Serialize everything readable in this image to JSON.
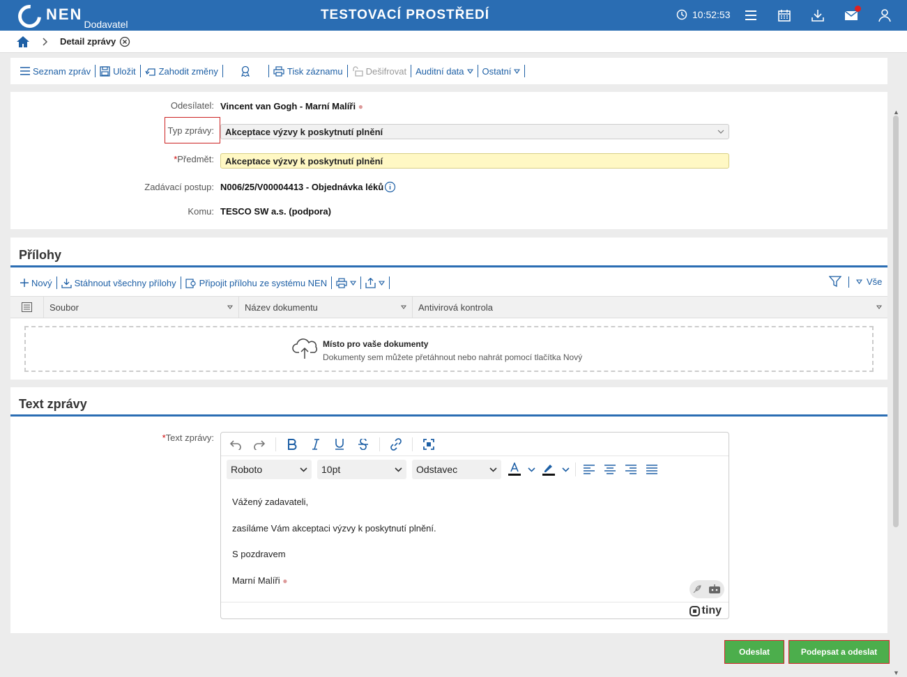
{
  "header": {
    "logo_text": "NEN",
    "logo_sub": "Dodavatel",
    "environment": "TESTOVACÍ PROSTŘEDÍ",
    "clock": "10:52:53"
  },
  "breadcrumb": {
    "title": "Detail zprávy"
  },
  "toolbar": {
    "list": "Seznam zpráv",
    "save": "Uložit",
    "discard": "Zahodit změny",
    "print": "Tisk záznamu",
    "decrypt": "Dešifrovat",
    "audit": "Auditní data",
    "other": "Ostatní"
  },
  "form": {
    "sender_label": "Odesílatel:",
    "sender_value": "Vincent van Gogh - Marní Malíři",
    "type_label": "Typ zprávy:",
    "type_value": "Akceptace výzvy k poskytnutí plnění",
    "subject_label": "Předmět:",
    "subject_value": "Akceptace výzvy k poskytnutí plnění",
    "procedure_label": "Zadávací postup:",
    "procedure_value": "N006/25/V00004413 - Objednávka léků",
    "to_label": "Komu:",
    "to_value": "TESCO SW a.s. (podpora)"
  },
  "attachments": {
    "title": "Přílohy",
    "new": "Nový",
    "download_all": "Stáhnout všechny přílohy",
    "attach_system": "Připojit přílohu ze systému NEN",
    "filter_all": "Vše",
    "columns": [
      "Soubor",
      "Název dokumentu",
      "Antivirová kontrola"
    ],
    "dropzone_title": "Místo pro vaše dokumenty",
    "dropzone_sub": "Dokumenty sem můžete přetáhnout nebo nahrát pomocí tlačítka Nový"
  },
  "message": {
    "title": "Text zprávy",
    "label": "Text zprávy:",
    "font": "Roboto",
    "size": "10pt",
    "block": "Odstavec",
    "lines": [
      "Vážený zadavateli,",
      "zasíláme Vám akceptaci výzvy k poskytnutí plnění.",
      "S pozdravem",
      "Marní Malíři"
    ],
    "brand": "tiny"
  },
  "actions": {
    "send": "Odeslat",
    "sign_send": "Podepsat a odeslat"
  },
  "colors": {
    "header": "#2a6db3",
    "link": "#1d5fa5",
    "green": "#4cae4c"
  }
}
